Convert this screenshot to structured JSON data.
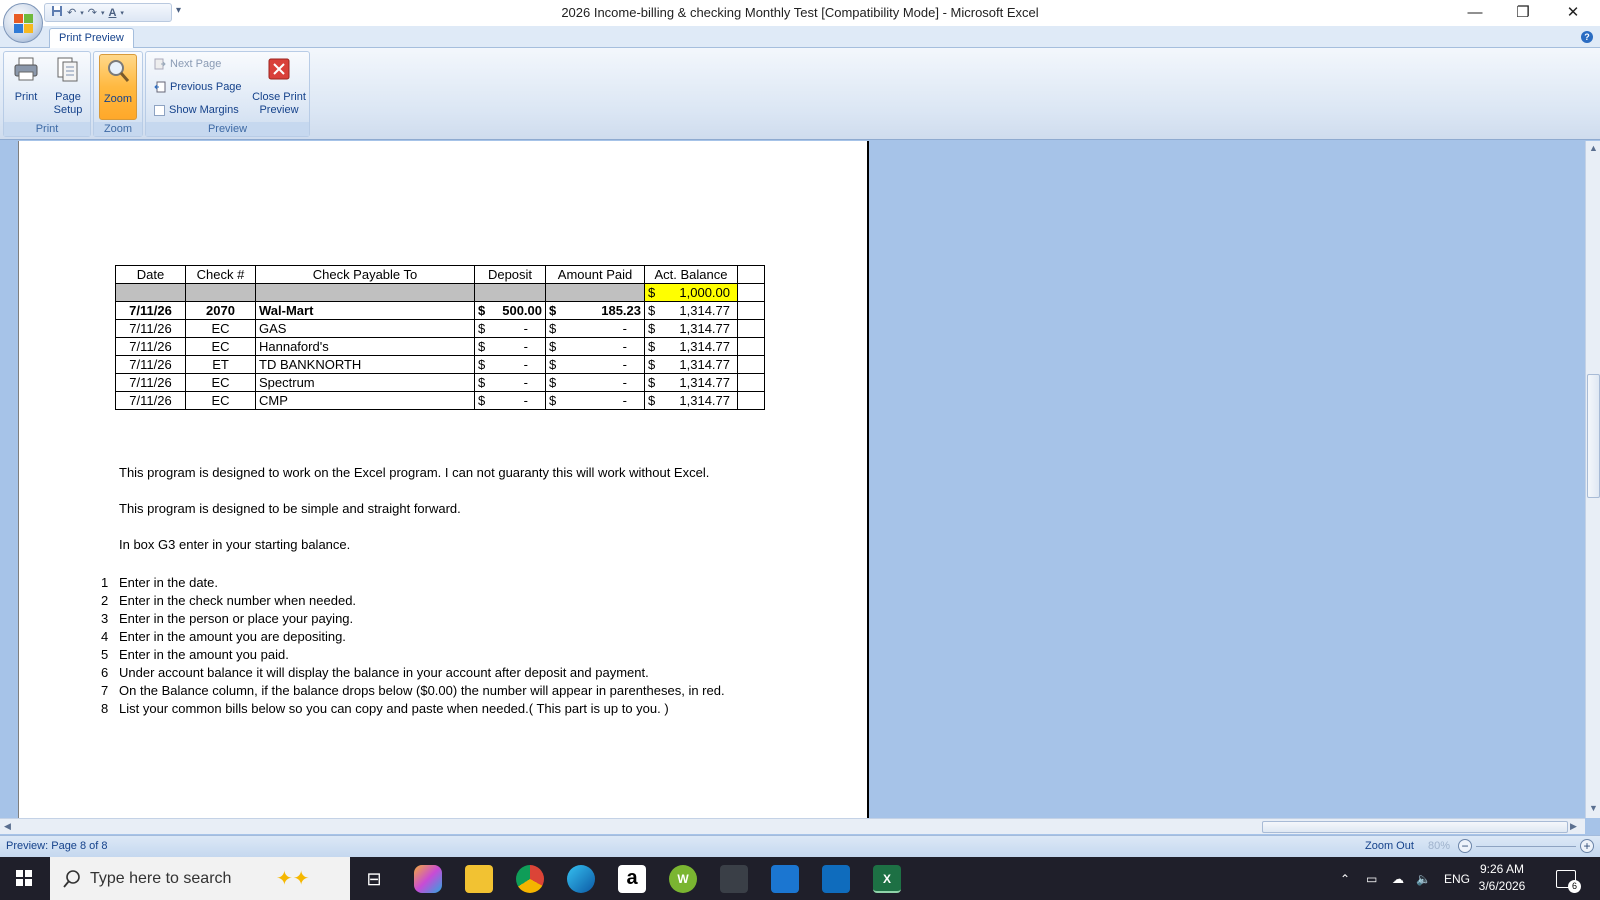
{
  "window": {
    "title": "2026 Income-billing & checking Monthly Test  [Compatibility Mode] - Microsoft Excel",
    "minimize": "—",
    "restore": "❐",
    "close": "✕"
  },
  "ribbon": {
    "active_tab": "Print Preview",
    "groups": {
      "print": {
        "label": "Print",
        "print_btn": "Print",
        "page_setup_l1": "Page",
        "page_setup_l2": "Setup"
      },
      "zoom": {
        "label": "Zoom",
        "zoom_btn": "Zoom"
      },
      "preview": {
        "label": "Preview",
        "next_page": "Next Page",
        "previous_page": "Previous Page",
        "show_margins": "Show Margins",
        "close_l1": "Close Print",
        "close_l2": "Preview"
      }
    }
  },
  "sheet": {
    "headers": [
      "Date",
      "Check #",
      "Check Payable To",
      "Deposit",
      "Amount Paid",
      "Act. Balance"
    ],
    "starting_balance": {
      "symbol": "$",
      "value": "1,000.00"
    },
    "rows": [
      {
        "date": "7/11/26",
        "check": "2070",
        "payee": "Wal-Mart",
        "dep_sym": "$",
        "dep": "500.00",
        "amt_sym": "$",
        "amt": "185.23",
        "bal_sym": "$",
        "bal": "1,314.77"
      },
      {
        "date": "7/11/26",
        "check": "EC",
        "payee": "GAS",
        "dep_sym": "$",
        "dep": "-",
        "amt_sym": "$",
        "amt": "-",
        "bal_sym": "$",
        "bal": "1,314.77"
      },
      {
        "date": "7/11/26",
        "check": "EC",
        "payee": "Hannaford's",
        "dep_sym": "$",
        "dep": "-",
        "amt_sym": "$",
        "amt": "-",
        "bal_sym": "$",
        "bal": "1,314.77"
      },
      {
        "date": "7/11/26",
        "check": "ET",
        "payee": "TD BANKNORTH",
        "dep_sym": "$",
        "dep": "-",
        "amt_sym": "$",
        "amt": "-",
        "bal_sym": "$",
        "bal": "1,314.77"
      },
      {
        "date": "7/11/26",
        "check": "EC",
        "payee": "Spectrum",
        "dep_sym": "$",
        "dep": "-",
        "amt_sym": "$",
        "amt": "-",
        "bal_sym": "$",
        "bal": "1,314.77"
      },
      {
        "date": "7/11/26",
        "check": "EC",
        "payee": "CMP",
        "dep_sym": "$",
        "dep": "-",
        "amt_sym": "$",
        "amt": "-",
        "bal_sym": "$",
        "bal": "1,314.77"
      }
    ],
    "notes": [
      "This program is designed to work on the Excel program. I can not guaranty this will work without Excel.",
      "This program is designed to be simple and straight forward.",
      "In box G3 enter in your starting balance."
    ],
    "steps": [
      {
        "n": "1",
        "text": "Enter in the date."
      },
      {
        "n": "2",
        "text": "Enter in the check number when needed."
      },
      {
        "n": "3",
        "text": "Enter in the person or place your paying."
      },
      {
        "n": "4",
        "text": "Enter in the amount you are depositing."
      },
      {
        "n": "5",
        "text": "Enter in the amount you paid."
      },
      {
        "n": "6",
        "text": "Under account balance it will display the balance in your account after deposit and payment."
      },
      {
        "n": "7",
        "text": "On the Balance column, if the balance drops below ($0.00) the number will appear in parentheses, in red."
      },
      {
        "n": "8",
        "text": "List your common bills below so you can copy and paste when needed.( This part is up to you. )"
      }
    ]
  },
  "status": {
    "page_info": "Preview: Page 8 of 8",
    "zoom_out": "Zoom Out",
    "zoom_pct": "80%"
  },
  "taskbar": {
    "search_placeholder": "Type here to search",
    "language": "ENG",
    "time": "9:26 AM",
    "date": "3/6/2026",
    "notifications": "6"
  },
  "colors": {
    "accent": "#15428b",
    "highlight": "#ffff00",
    "workspace": "#a6c3e8"
  }
}
